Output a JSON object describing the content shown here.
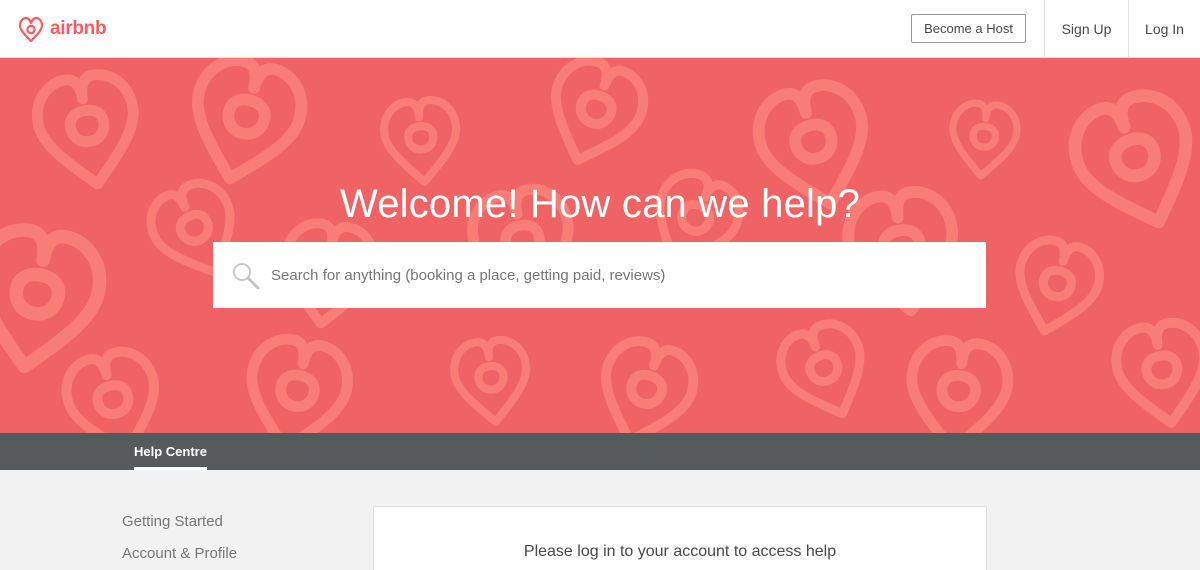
{
  "header": {
    "logo_text": "airbnb",
    "become_host": "Become a Host",
    "sign_up": "Sign Up",
    "log_in": "Log In"
  },
  "hero": {
    "title": "Welcome! How can we help?",
    "search": {
      "placeholder": "Search for anything (booking a place, getting paid, reviews)",
      "value": ""
    }
  },
  "subnav": {
    "tab": "Help Centre"
  },
  "sidebar": {
    "items": [
      "Getting Started",
      "Account & Profile"
    ]
  },
  "main": {
    "login_card_title": "Please log in to your account to access help"
  },
  "colors": {
    "brand": "#ff5a5f",
    "hero_background": "#f06365",
    "subnav_background": "#565a5c"
  },
  "icons": {
    "logo": "airbnb-belo-icon",
    "search": "magnifier-icon"
  }
}
